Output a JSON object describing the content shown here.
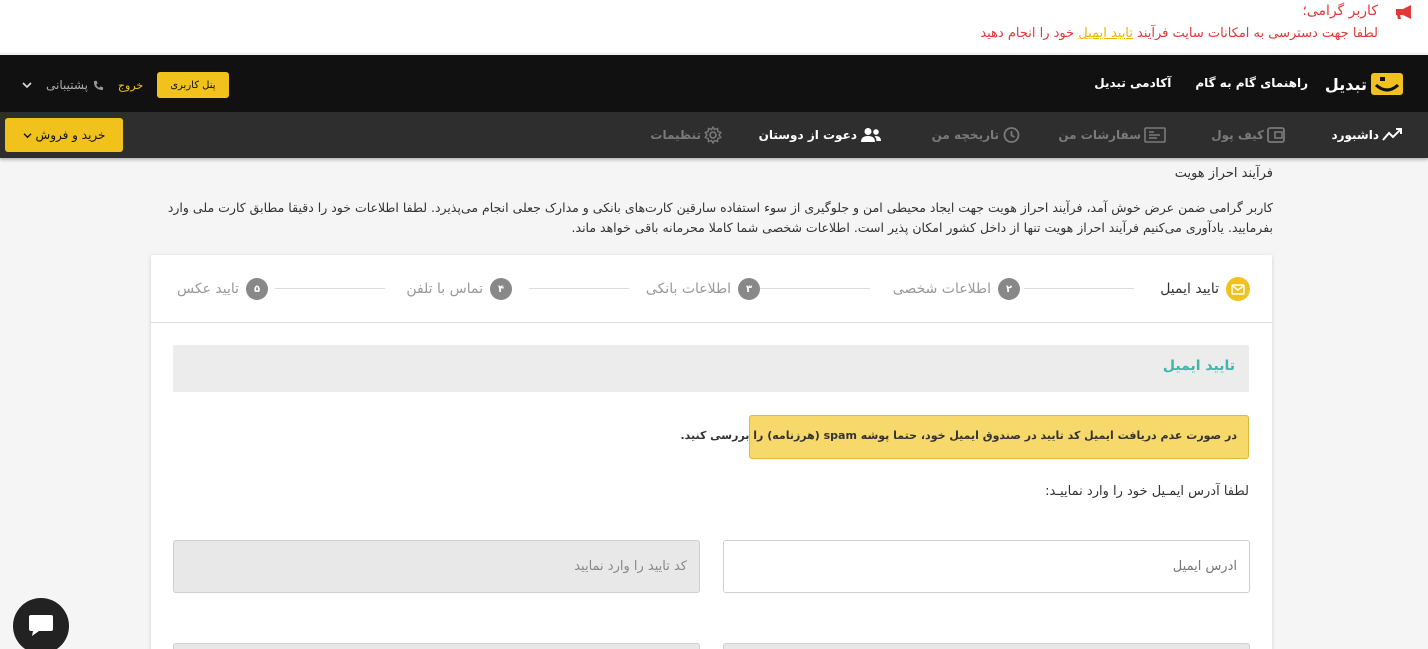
{
  "alert": {
    "greeting": "کاربر گرامی؛",
    "message_before": "لطفا جهت دسترسی به امکانات سایت فرآیند ",
    "message_link": "تایید ایمیل",
    "message_after": " خود را انجام دهید",
    "icon": "megaphone-icon"
  },
  "header": {
    "logo_text": "تبدیل",
    "nav": [
      "راهنمای گام به گام",
      "آکادمی تبدیل"
    ],
    "support_label": "پشتیبانی",
    "exit_label": "خروج",
    "panel_button": "پنل کاربری"
  },
  "subnav": {
    "dashboard": "داشبورد",
    "wallet": "کیف پول",
    "orders": "سفارشات من",
    "history": "تاریخچه من",
    "invite": "دعوت از دوستان",
    "settings": "تنظیمات",
    "buy_sell": "خرید و فروش"
  },
  "intro": {
    "title": "فرآیند احراز هویت",
    "text": "کاربر گرامی ضمن عرض خوش آمد، فرآیند احراز هویت جهت ایجاد محیطی امن و جلوگیری از سوء استفاده سارقین کارت‌های بانکی و مدارک جعلی انجام می‌پذیرد. لطفا اطلاعات خود را دقیقا مطابق کارت ملی وارد بفرمایید. یادآوری می‌کنیم فرآیند احراز هویت تنها از داخل کشور امکان پذیر است. اطلاعات شخصی شما کاملا محرمانه باقی خواهد ماند."
  },
  "steps": [
    {
      "num": "",
      "label": "تایید ایمیل"
    },
    {
      "num": "۲",
      "label": "اطلاعات شخصی"
    },
    {
      "num": "۳",
      "label": "اطلاعات بانکی"
    },
    {
      "num": "۴",
      "label": "تماس با تلفن"
    },
    {
      "num": "۵",
      "label": "تایید عکس"
    }
  ],
  "email_section": {
    "title": "تایید ایمیل",
    "warning": "در صورت عدم دریافت ایمیل کد تایید در صندوق ایمیل خود، حتما پوشه spam (هرزنامه) را بررسی کنید.",
    "prompt": "لطفا آدرس ایمـیل خود را وارد نماییـد:",
    "email_placeholder": "آدرس ایمیل",
    "code_placeholder": "کد تایید را وارد نمایید"
  },
  "colors": {
    "accent": "#f1c21b",
    "alert_text": "#e23838",
    "section_title": "#3bb8a8"
  }
}
